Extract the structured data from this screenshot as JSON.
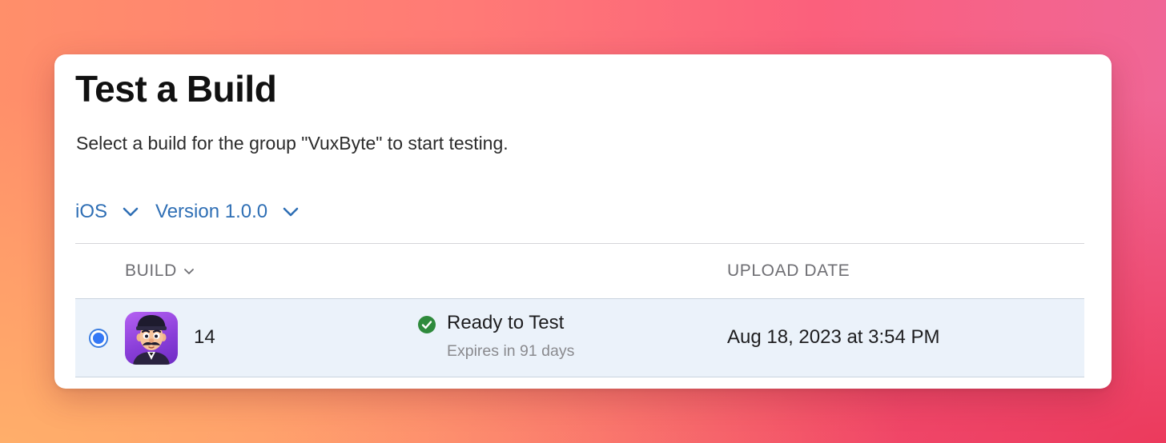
{
  "dialog": {
    "title": "Test a Build",
    "subtitle": "Select a build for the group \"VuxByte\" to start testing."
  },
  "filters": {
    "platform": {
      "label": "iOS",
      "icon": "chevron-down-icon"
    },
    "version": {
      "label": "Version 1.0.0",
      "icon": "chevron-down-icon"
    }
  },
  "table": {
    "columns": {
      "build": "BUILD",
      "upload_date": "UPLOAD DATE"
    },
    "rows": [
      {
        "selected": true,
        "app_icon": "app-avatar-icon",
        "build": "14",
        "status": "Ready to Test",
        "status_icon": "checkmark-circle-icon",
        "status_color": "#2e8a3c",
        "expiry": "Expires in 91 days",
        "upload_date": "Aug 18, 2023 at 3:54 PM"
      }
    ]
  },
  "colors": {
    "accent": "#2f6fb5",
    "radio": "#3478f6",
    "selected_row": "#ebf2fa"
  }
}
